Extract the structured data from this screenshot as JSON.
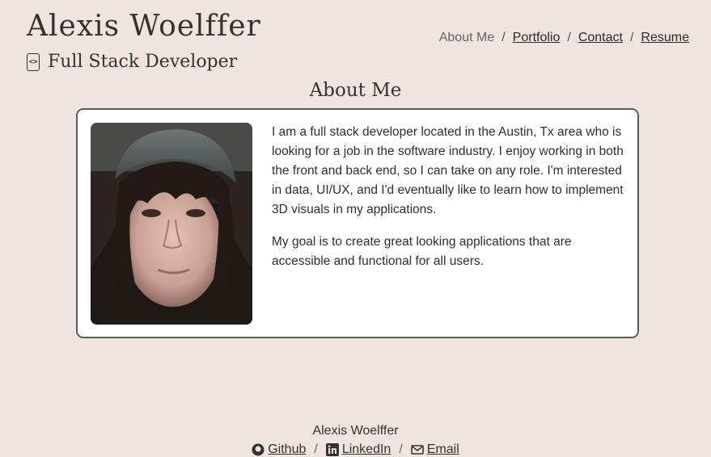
{
  "header": {
    "name": "Alexis Woelffer",
    "role": "Full Stack Developer",
    "role_icon": "code-icon"
  },
  "nav": {
    "about": "About Me",
    "portfolio": "Portfolio",
    "contact": "Contact",
    "resume": "Resume",
    "separator": "/"
  },
  "about": {
    "title": "About Me",
    "paragraph1": "I am a full stack developer located in the Austin, Tx area who is looking for a job in the software industry. I enjoy working in both the front and back end, so I can take on any role. I'm interested in data, UI/UX, and I'd eventually like to learn how to implement 3D visuals in my applications.",
    "paragraph2": "My goal is to create great looking applications that are accessible and functional for all users."
  },
  "footer": {
    "name": "Alexis Woelffer",
    "github": "Github",
    "linkedin": "LinkedIn",
    "email": "Email",
    "separator": "/"
  },
  "colors": {
    "background": "#f0e4df",
    "card": "#ffffff",
    "border": "#5b5b5b",
    "text": "#2b2b2b"
  }
}
